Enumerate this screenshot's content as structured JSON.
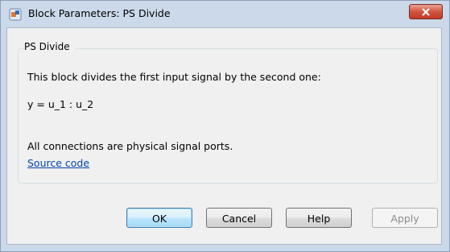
{
  "window": {
    "title": "Block Parameters: PS Divide",
    "title_icon": "simulink-block-icon",
    "close_icon": "close-icon"
  },
  "group": {
    "title": "PS Divide",
    "description": "This block divides the first input signal by the second one:",
    "equation": "y = u_1 : u_2",
    "connections_note": "All connections are physical signal ports.",
    "link_label": "Source code"
  },
  "buttons": {
    "ok": "OK",
    "cancel": "Cancel",
    "help": "Help",
    "apply": "Apply"
  },
  "colors": {
    "link": "#0645ad",
    "close_button": "#c9402c",
    "frame": "#cbd9ea"
  }
}
